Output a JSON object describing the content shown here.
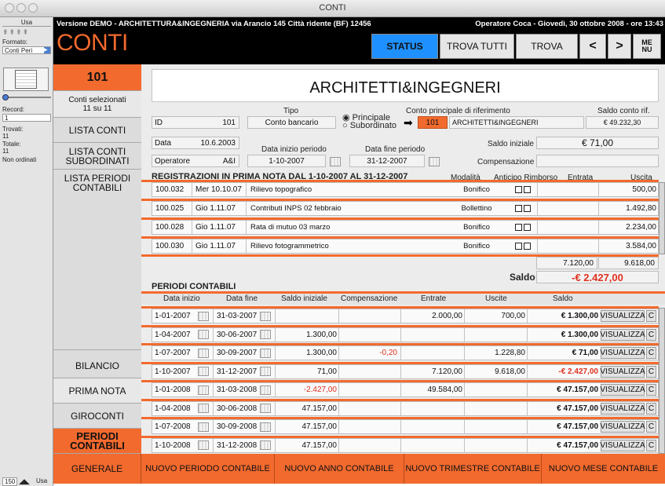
{
  "window": {
    "title": "CONTI"
  },
  "toolpane": {
    "usa": "Usa",
    "formato_label": "Formato:",
    "formato_value": "Conti Peri",
    "record_label": "Record:",
    "record_value": "1",
    "trovati_label": "Trovati:",
    "trovati_value": "11",
    "totale_label": "Totale:",
    "totale_value": "11",
    "non_ordinati": "Non ordinati",
    "zoom": "150",
    "mode": "Usa"
  },
  "banner": {
    "demo_text": "Versione DEMO - ARCHITETTURA&INGEGNERIA via Arancio 145 Città ridente (BF) 12456",
    "operator_text": "Operatore Coca - Giovedì, 30 ottobre 2008 - ore 13:43",
    "logo": "CONTI",
    "buttons": {
      "status": "STATUS",
      "trova_tutti": "TROVA TUTTI",
      "trova": "TROVA",
      "prev": "<",
      "next": ">",
      "menu_1": "ME",
      "menu_2": "NU"
    }
  },
  "nav": {
    "number": "101",
    "selected_1": "Conti selezionati",
    "selected_2": "11 su 11",
    "lista_conti": "LISTA CONTI",
    "lista_sub_1": "LISTA  CONTI",
    "lista_sub_2": "SUBORDINATI",
    "lista_periodi_1": "LISTA PERIODI",
    "lista_periodi_2": "CONTABILI",
    "bilancio": "BILANCIO",
    "prima_nota": "PRIMA NOTA",
    "giroconti": "GIROCONTI",
    "periodi_1": "PERIODI",
    "periodi_2": "CONTABILI",
    "generale": "GENERALE"
  },
  "record": {
    "name": "ARCHITETTI&INGEGNERI",
    "id_label": "ID",
    "id_value": "101",
    "tipo_label": "Tipo",
    "tipo_value": "Conto bancario",
    "radio_principale": "Principale",
    "radio_subordinato": "Subordinato",
    "conto_rif_label": "Conto principale di riferimento",
    "conto_rif_num": "101",
    "conto_rif_name": "ARCHITETTI&INGEGNERI",
    "saldo_rif_label": "Saldo conto rif.",
    "saldo_rif_value": "€ 49.232,30",
    "data_label": "Data",
    "data_value": "10.6.2003",
    "inizio_label": "Data inizio periodo",
    "inizio_value": "1-10-2007",
    "fine_label": "Data fine periodo",
    "fine_value": "31-12-2007",
    "saldo_iniziale_label": "Saldo iniziale",
    "saldo_iniziale_value": "€ 71,00",
    "operatore_label": "Operatore",
    "operatore_value": "A&I",
    "compensazione_label": "Compensazione"
  },
  "registrazioni": {
    "title": "REGISTRAZIONI IN PRIMA NOTA DAL 1-10-2007 AL 31-12-2007",
    "col_modalita": "Modalità",
    "col_anticipo": "Anticipo Rimborso",
    "col_entrata": "Entrata",
    "col_uscita": "Uscita",
    "rows": [
      {
        "num": "100.032",
        "date": "Mer 10.10.07",
        "desc": "Rilievo topografico",
        "mode": "Bonifico",
        "entrata": "",
        "uscita": "500,00"
      },
      {
        "num": "100.025",
        "date": "Gio 1.11.07",
        "desc": "Contributi INPS 02 febbraio",
        "mode": "Bollettino",
        "entrata": "",
        "uscita": "1.492,80"
      },
      {
        "num": "100.028",
        "date": "Gio 1.11.07",
        "desc": "Rata di mutuo 03 marzo",
        "mode": "Bonifico",
        "entrata": "",
        "uscita": "2.234,00"
      },
      {
        "num": "100.030",
        "date": "Gio 1.11.07",
        "desc": "Rilievo fotogrammetrico",
        "mode": "Bonifico",
        "entrata": "",
        "uscita": "3.584,00"
      }
    ],
    "total_entrata": "7.120,00",
    "total_uscita": "9.618,00",
    "saldo_label": "Saldo",
    "saldo_value": "-€ 2.427,00"
  },
  "periodi": {
    "title": "PERIODI CONTABILI",
    "col_inizio": "Data inizio",
    "col_fine": "Data fine",
    "col_saldo_iniziale": "Saldo iniziale",
    "col_compensazione": "Compensazione",
    "col_entrate": "Entrate",
    "col_uscite": "Uscite",
    "col_saldo": "Saldo",
    "visualizza": "VISUALIZZA",
    "c": "C",
    "rows": [
      {
        "start": "1-01-2007",
        "end": "31-03-2007",
        "saldo_ini": "",
        "comp": "",
        "entrate": "2.000,00",
        "uscite": "700,00",
        "saldo": "€ 1.300,00"
      },
      {
        "start": "1-04-2007",
        "end": "30-06-2007",
        "saldo_ini": "1.300,00",
        "comp": "",
        "entrate": "",
        "uscite": "",
        "saldo": "€ 1.300,00"
      },
      {
        "start": "1-07-2007",
        "end": "30-09-2007",
        "saldo_ini": "1.300,00",
        "comp": "-0,20",
        "entrate": "",
        "uscite": "1.228,80",
        "saldo": "€ 71,00"
      },
      {
        "start": "1-10-2007",
        "end": "31-12-2007",
        "saldo_ini": "71,00",
        "comp": "",
        "entrate": "7.120,00",
        "uscite": "9.618,00",
        "saldo": "-€ 2.427,00"
      },
      {
        "start": "1-01-2008",
        "end": "31-03-2008",
        "saldo_ini": "-2.427,00",
        "comp": "",
        "entrate": "49.584,00",
        "uscite": "",
        "saldo": "€ 47.157,00"
      },
      {
        "start": "1-04-2008",
        "end": "30-06-2008",
        "saldo_ini": "47.157,00",
        "comp": "",
        "entrate": "",
        "uscite": "",
        "saldo": "€ 47.157,00"
      },
      {
        "start": "1-07-2008",
        "end": "30-09-2008",
        "saldo_ini": "47.157,00",
        "comp": "",
        "entrate": "",
        "uscite": "",
        "saldo": "€ 47.157,00"
      },
      {
        "start": "1-10-2008",
        "end": "31-12-2008",
        "saldo_ini": "47.157,00",
        "comp": "",
        "entrate": "",
        "uscite": "",
        "saldo": "€ 47.157,00"
      }
    ]
  },
  "bottom": {
    "nuovo_periodo": "NUOVO PERIODO CONTABILE",
    "nuovo_anno": "NUOVO ANNO CONTABILE",
    "nuovo_trimestre": "NUOVO TRIMESTRE CONTABILE",
    "nuovo_mese": "NUOVO MESE CONTABILE"
  },
  "colors": {
    "accent": "#f26a2e",
    "status": "#1e90ff",
    "negative": "#e0301e"
  }
}
